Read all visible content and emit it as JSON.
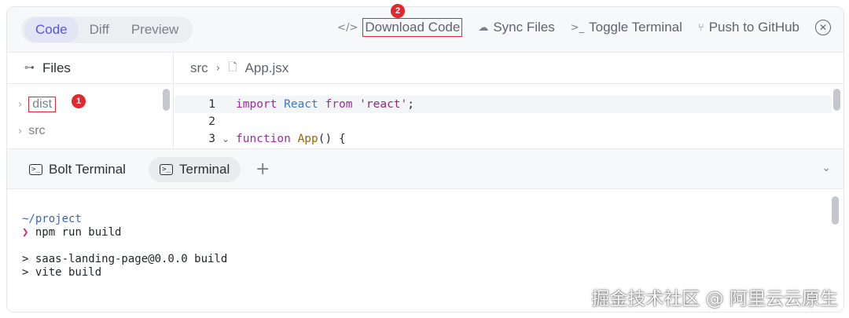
{
  "toolbar": {
    "view_tabs": [
      {
        "label": "Code",
        "active": true
      },
      {
        "label": "Diff",
        "active": false
      },
      {
        "label": "Preview",
        "active": false
      }
    ],
    "actions": [
      {
        "icon": "code-brackets-icon",
        "glyph": "</>",
        "label": "Download Code"
      },
      {
        "icon": "cloud-sync-icon",
        "glyph": "☁",
        "label": "Sync Files"
      },
      {
        "icon": "terminal-prompt-icon",
        "glyph": ">_",
        "label": "Toggle Terminal"
      },
      {
        "icon": "git-branch-icon",
        "glyph": "⑂",
        "label": "Push to GitHub"
      }
    ],
    "close_glyph": "✕"
  },
  "annotations": {
    "badge_1": "1",
    "badge_2": "2",
    "highlight_color": "#e0282d"
  },
  "files": {
    "header": "Files",
    "items": [
      {
        "name": "dist",
        "chevron": "›"
      },
      {
        "name": "src",
        "chevron": "›"
      }
    ]
  },
  "editor": {
    "breadcrumb": [
      "src",
      "App.jsx"
    ],
    "lines": [
      {
        "num": "1",
        "tokens": [
          "import",
          " React ",
          "from",
          " ",
          "'react'",
          ";"
        ]
      },
      {
        "num": "2",
        "tokens": []
      },
      {
        "num": "3",
        "tokens": [
          "function",
          " ",
          "App",
          "() {"
        ]
      }
    ]
  },
  "terminal": {
    "tabs": [
      {
        "label": "Bolt Terminal",
        "active": false
      },
      {
        "label": "Terminal",
        "active": true
      }
    ],
    "add_glyph": "+",
    "collapse_glyph": "⌄",
    "prompt_symbol": "❯",
    "lines": [
      "~/project",
      " npm run build",
      "",
      "> saas-landing-page@0.0.0 build",
      "> vite build"
    ]
  },
  "watermark": "掘金技术社区 @ 阿里云云原生",
  "colors": {
    "accent": "#5a55d6",
    "terminal_path": "#3864b8",
    "prompt": "#c0267a"
  }
}
